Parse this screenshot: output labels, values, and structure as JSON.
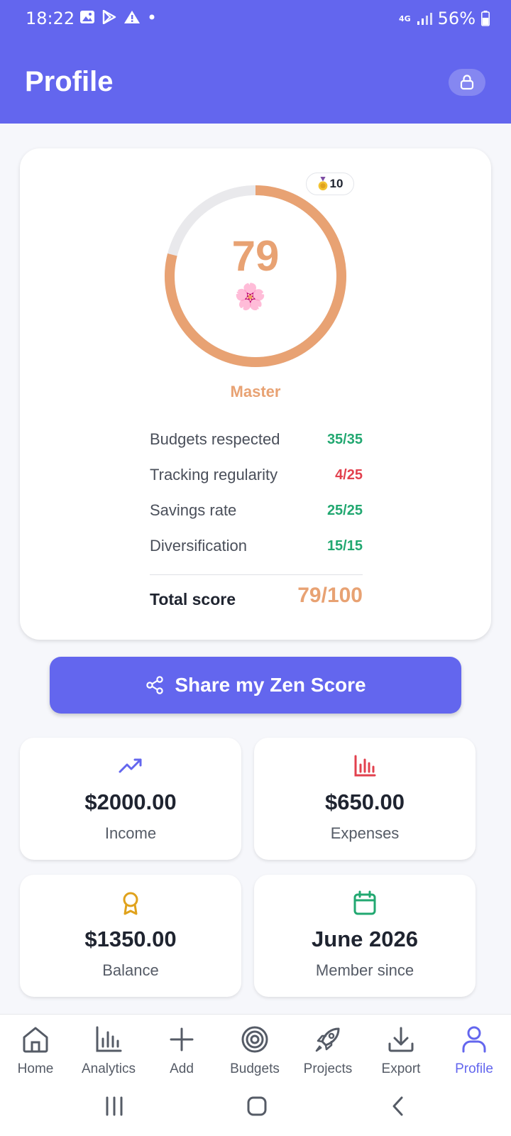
{
  "status_bar": {
    "time": "18:22",
    "network": "4G",
    "battery": "56%"
  },
  "header": {
    "title": "Profile",
    "lock_icon": "lock-icon"
  },
  "score_card": {
    "score": "79",
    "score_fraction": 0.79,
    "badge_count": "10",
    "level": "Master",
    "rows": [
      {
        "label": "Budgets respected",
        "value": "35/35",
        "color": "#22a871"
      },
      {
        "label": "Tracking regularity",
        "value": "4/25",
        "color": "#e2414e"
      },
      {
        "label": "Savings rate",
        "value": "25/25",
        "color": "#22a871"
      },
      {
        "label": "Diversification",
        "value": "15/15",
        "color": "#22a871"
      }
    ],
    "total_label": "Total score",
    "total_value": "79/100",
    "accent": "#e8a273"
  },
  "share_button": {
    "label": "Share my Zen Score",
    "icon": "share-icon"
  },
  "stats": [
    {
      "amount": "$2000.00",
      "caption": "Income",
      "icon": "trending-up-icon",
      "color": "#6366ee"
    },
    {
      "amount": "$650.00",
      "caption": "Expenses",
      "icon": "bar-chart-icon",
      "color": "#e2414e"
    },
    {
      "amount": "$1350.00",
      "caption": "Balance",
      "icon": "award-icon",
      "color": "#e0a21c"
    },
    {
      "amount": "June 2026",
      "caption": "Member since",
      "icon": "calendar-icon",
      "color": "#22a871"
    }
  ],
  "bottom_nav": [
    {
      "label": "Home",
      "icon": "home-icon"
    },
    {
      "label": "Analytics",
      "icon": "analytics-icon"
    },
    {
      "label": "Add",
      "icon": "plus-icon"
    },
    {
      "label": "Budgets",
      "icon": "target-icon"
    },
    {
      "label": "Projects",
      "icon": "rocket-icon"
    },
    {
      "label": "Export",
      "icon": "download-icon"
    },
    {
      "label": "Profile",
      "icon": "user-icon",
      "active": true
    }
  ],
  "colors": {
    "primary": "#6366ee",
    "background": "#f6f7fb"
  }
}
